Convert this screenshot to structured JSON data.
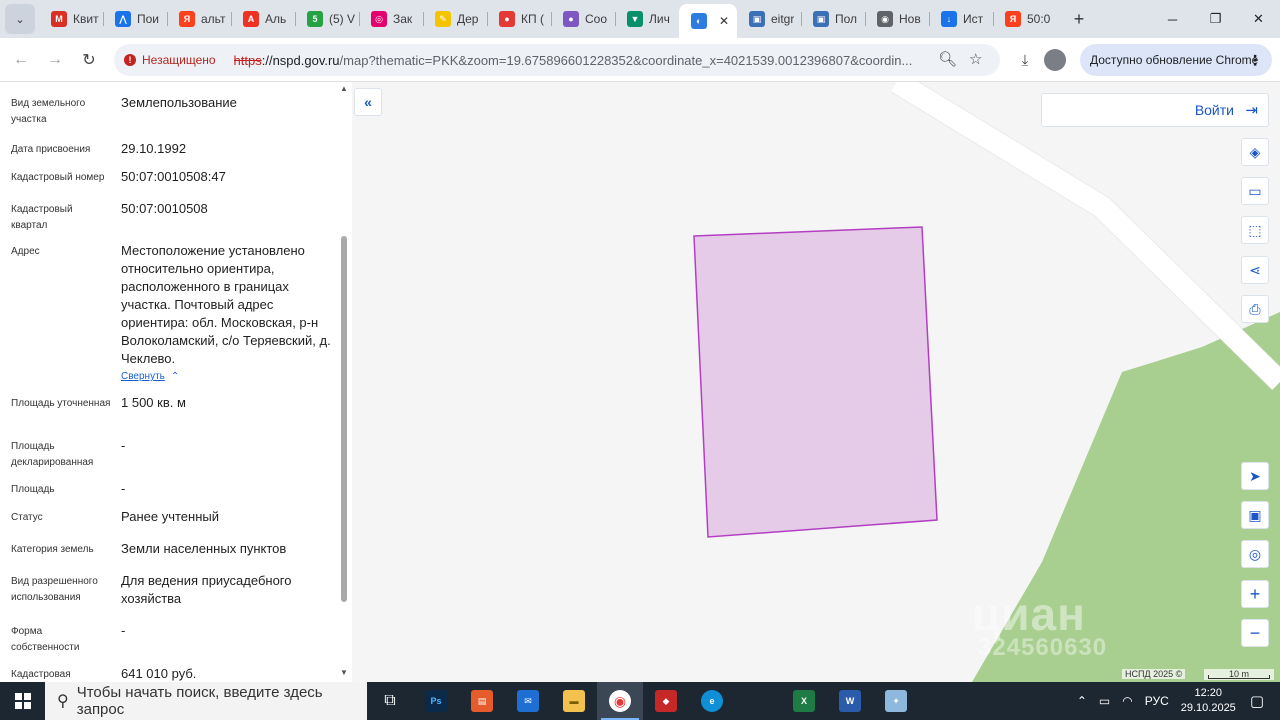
{
  "browser": {
    "tabs": [
      {
        "title": "Квит",
        "icon": "gmail-icon",
        "color": "#d93025",
        "glyph": "M"
      },
      {
        "title": "Пои",
        "icon": "arrow-logo-icon",
        "color": "#1a73e8",
        "glyph": "⋀"
      },
      {
        "title": "альт",
        "icon": "yandex-icon",
        "color": "#fc3f1d",
        "glyph": "Я"
      },
      {
        "title": "Аль",
        "icon": "alfa-icon",
        "color": "#ef3124",
        "glyph": "А"
      },
      {
        "title": "(5) V",
        "icon": "whatsapp-icon",
        "color": "#25a244",
        "glyph": "5"
      },
      {
        "title": "Зак",
        "icon": "mail-icon",
        "color": "#e3006d",
        "glyph": "◎"
      },
      {
        "title": "Дер",
        "icon": "pencil-icon",
        "color": "#f5c400",
        "glyph": "✎"
      },
      {
        "title": "КП (",
        "icon": "pin-icon",
        "color": "#e53935",
        "glyph": "●"
      },
      {
        "title": "Соо",
        "icon": "bubbles-icon",
        "color": "#7e57c2",
        "glyph": "●"
      },
      {
        "title": "Лич",
        "icon": "shield-icon",
        "color": "#0a8f6b",
        "glyph": "▼"
      },
      {
        "title": "",
        "icon": "nspd-icon",
        "color": "#2d7de0",
        "glyph": "◐",
        "active": true
      },
      {
        "title": "eitgr",
        "icon": "image-icon",
        "color": "#3b6fb6",
        "glyph": "▣"
      },
      {
        "title": "Пол",
        "icon": "image-icon",
        "color": "#3b6fb6",
        "glyph": "▣"
      },
      {
        "title": "Нов",
        "icon": "chrome-icon",
        "color": "#5f6368",
        "glyph": "◉"
      },
      {
        "title": "Ист",
        "icon": "download-icon",
        "color": "#1a73e8",
        "glyph": "↓"
      },
      {
        "title": "50:0",
        "icon": "yandex-icon",
        "color": "#fc3f1d",
        "glyph": "Я"
      }
    ],
    "new_tab": "+",
    "tab_close": "✕",
    "insecure_label": "Незащищено",
    "url_scheme": "https",
    "url_host": "://nspd.gov.ru",
    "url_rest": "/map?thematic=PKK&zoom=19.675896601228352&coordinate_x=4021539.0012396807&coordin...",
    "update_label": "Доступно обновление Chrome"
  },
  "panel": {
    "fields": [
      {
        "label": "Вид земельного участка",
        "value": "Землепользование"
      },
      {
        "label": "Дата присвоения",
        "value": "29.10.1992"
      },
      {
        "label": "Кадастровый номер",
        "value": "50:07:0010508:47"
      },
      {
        "label": "Кадастровый квартал",
        "value": "50:07:0010508"
      },
      {
        "label": "Адрес",
        "value": "Местоположение установлено относительно ориентира, расположенного в границах участка. Почтовый адрес ориентира: обл. Московская, р-н Волоколамский, с/о Теряевский, д. Чеклево."
      },
      {
        "label": "Площадь уточненная",
        "value": "1 500 кв. м"
      },
      {
        "label": "Площадь декларированная",
        "value": "-"
      },
      {
        "label": "Площадь",
        "value": "-"
      },
      {
        "label": "Статус",
        "value": "Ранее учтенный"
      },
      {
        "label": "Категория земель",
        "value": "Земли населенных пунктов"
      },
      {
        "label": "Вид разрешенного использования",
        "value": "Для ведения приусадебного хозяйства"
      },
      {
        "label": "Форма собственности",
        "value": "-"
      },
      {
        "label": "Кадастровая",
        "value": "641 010 руб."
      }
    ],
    "collapse_link": "Свернуть",
    "collapse_chevron": "⌃"
  },
  "map": {
    "login_label": "Войти",
    "watermark": "циан",
    "watermark_id": "324560630",
    "copyright": "НСПД 2025 ©",
    "scale_label": "10 m",
    "colors": {
      "parcel_fill": "#e6cbe8",
      "parcel_stroke": "#b23fc2",
      "forest": "#a8cf90",
      "road": "#ffffff",
      "accent": "#1a56c4"
    }
  },
  "taskbar": {
    "search_placeholder": "Чтобы начать поиск, введите здесь запрос",
    "lang": "РУС",
    "time": "12:20",
    "date": "29.10.2025"
  }
}
